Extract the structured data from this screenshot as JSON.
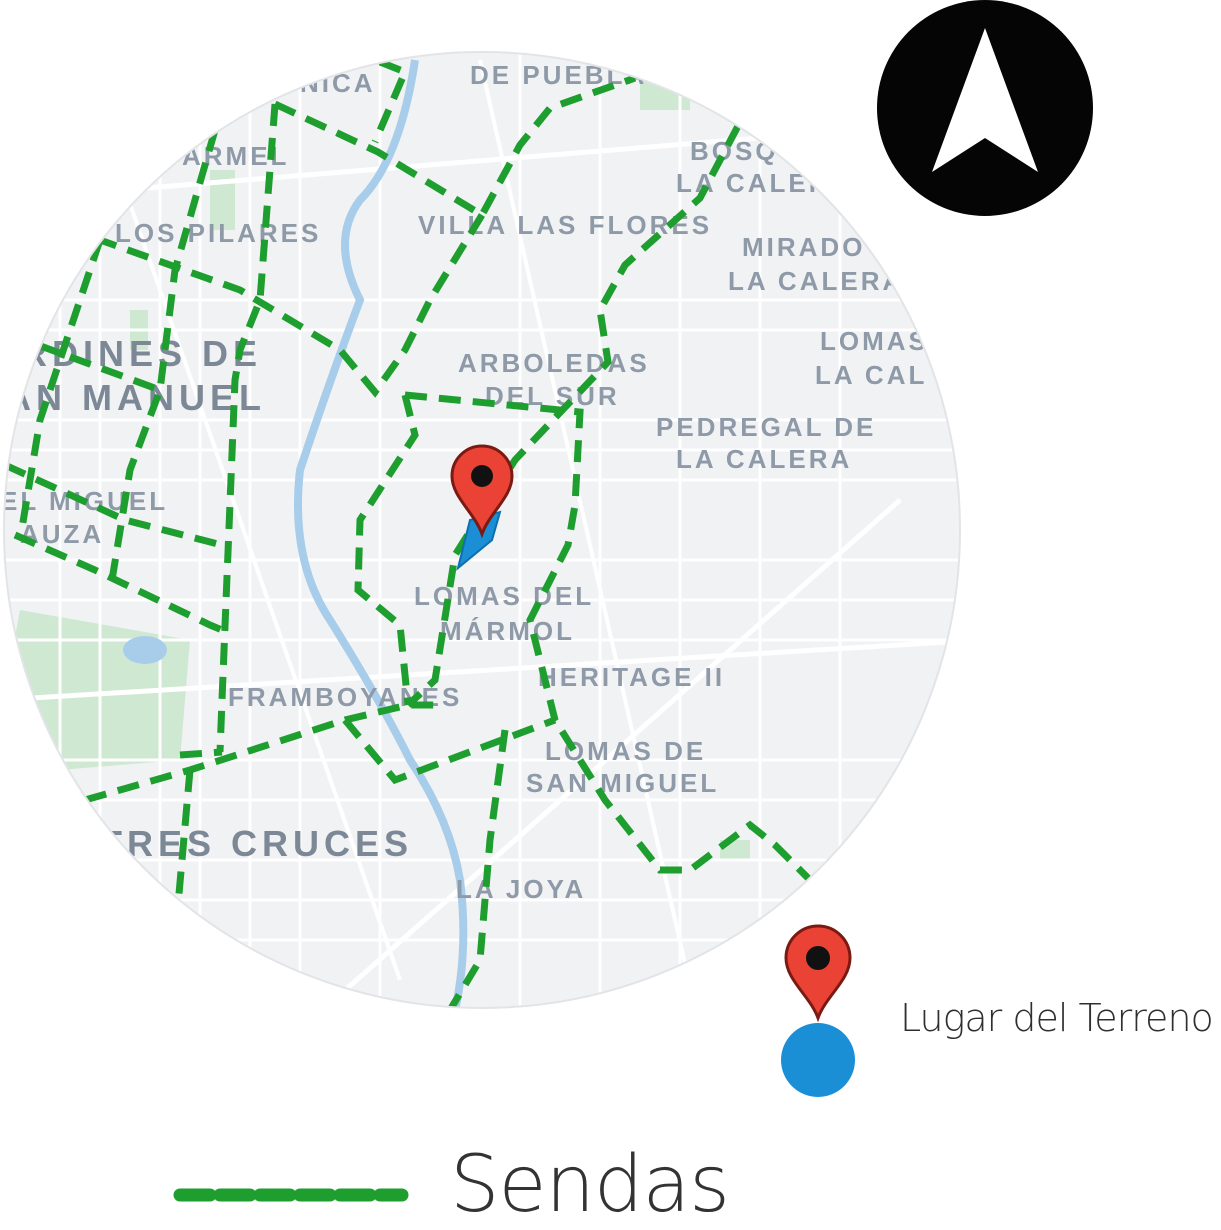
{
  "map": {
    "place_labels": [
      "NICA",
      "DE PUEBLA",
      "ARMEL",
      "BOSQ",
      "LA CALER",
      "LOS PILARES",
      "VILLA LAS FLORES",
      "MIRADO",
      "LA CALERA",
      "LOMAS",
      "LA CAL",
      "ARDINES DE",
      "AN MANUEL",
      "ARBOLEDAS",
      "DEL SUR",
      "PEDREGAL DE",
      "LA CALERA",
      "EL MIGUEL",
      "AUZA",
      "LOMAS DEL",
      "MÁRMOL",
      "HERITAGE II",
      "FRAMBOYANES",
      "LOMAS DE",
      "SAN MIGUEL",
      "TRES CRUCES",
      "LA JOYA"
    ],
    "north_arrow_icon": "north-arrow-icon",
    "marker_icon": "map-pin-icon",
    "colors": {
      "background": "#f1f2f4",
      "streets": "#ffffff",
      "parks": "#cfe8d2",
      "river": "#a8cdea",
      "path": "#1e9e2e",
      "marker": "#ea4335",
      "parcel": "#1a8fd6"
    }
  },
  "legend": {
    "lugar_label": "Lugar del Terreno",
    "sendas_label": "Sendas"
  }
}
